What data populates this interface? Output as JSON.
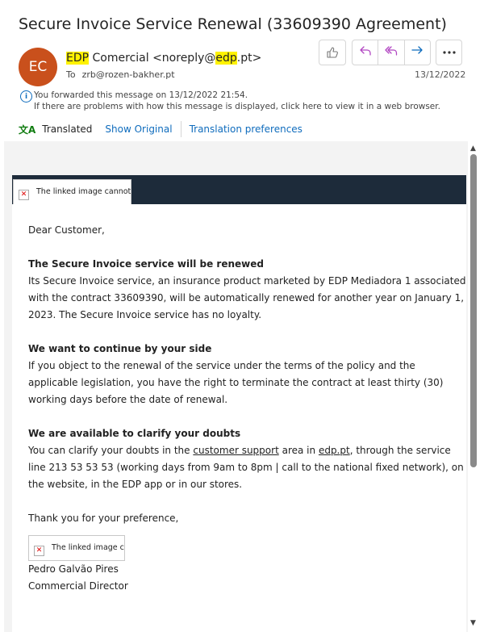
{
  "subject": "Secure Invoice Service Renewal (33609390 Agreement)",
  "sender": {
    "avatar_initials": "EC",
    "name_brand": "EDP",
    "name_rest": " Comercial <noreply@",
    "domain_brand": "edp",
    "domain_rest": ".pt>",
    "to_label": "To",
    "to_address": "zrb@rozen-bakher.pt",
    "date": "13/12/2022"
  },
  "info": {
    "line1": "You forwarded this message on 13/12/2022 21:54.",
    "line2": "If there are problems with how this message is displayed, click here to view it in a web browser."
  },
  "translation": {
    "status": "Translated",
    "show_original": "Show Original",
    "preferences": "Translation preferences"
  },
  "broken_image_caption": "The linked image cannot be displayed",
  "email": {
    "greeting": "Dear Customer,",
    "h1": "The Secure Invoice service will be renewed",
    "p1": "Its Secure Invoice service, an insurance product marketed by EDP Mediadora 1 associated with the contract 33609390, will be automatically renewed for another year on January 1, 2023. The Secure Invoice service has no loyalty.",
    "h2": "We want to continue by your side",
    "p2": "If you object to the renewal of the service under the terms of the policy and the applicable legislation, you have the right to terminate the contract at least thirty (30) working days before the date of renewal.",
    "h3": "We are available to clarify your doubts",
    "p3_a": "You can clarify your doubts in the ",
    "p3_link1": "customer support",
    "p3_b": " area in ",
    "p3_link2": "edp.pt",
    "p3_c": ", through the service line 213 53 53 53 (working days from 9am to 8pm | call to the national fixed network), on the website, in the EDP app or in our stores.",
    "thanks": "Thank you for your preference,",
    "signer_name": "Pedro Galvão Pires",
    "signer_title": "Commercial Director"
  },
  "icons": {
    "like": "thumbs-up-icon",
    "reply": "reply-icon",
    "reply_all": "reply-all-icon",
    "forward": "forward-icon",
    "more": "more-icon",
    "info": "info-icon",
    "translate": "translate-icon"
  },
  "colors": {
    "avatar": "#c9501c",
    "highlight": "#fff200",
    "reply_purple": "#b146c2",
    "forward_blue": "#0f6cbd",
    "banner": "#1d2b3a"
  }
}
